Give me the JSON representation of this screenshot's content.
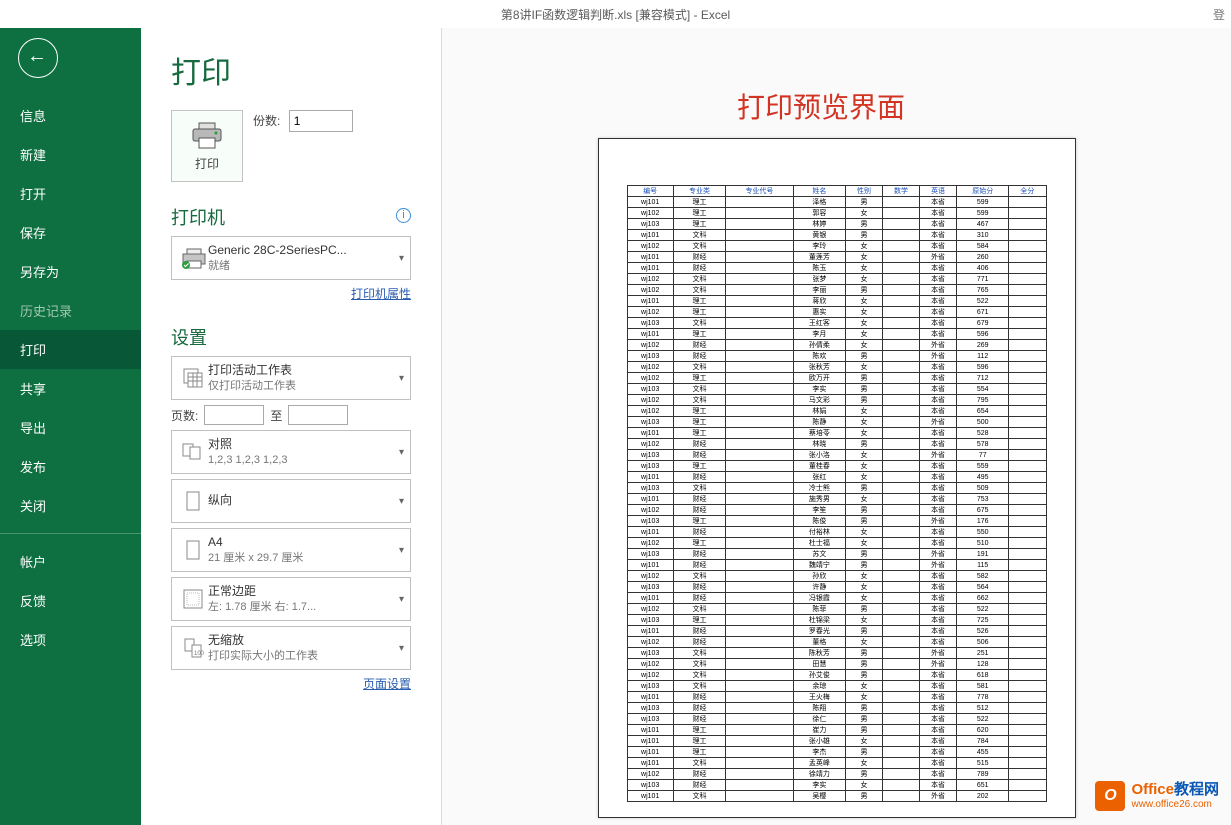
{
  "titlebar": {
    "text": "第8讲IF函数逻辑判断.xls  [兼容模式]  -  Excel",
    "right": "登"
  },
  "annotation": "打印预览界面",
  "sidebar": {
    "items": [
      "信息",
      "新建",
      "打开",
      "保存",
      "另存为",
      "历史记录",
      "打印",
      "共享",
      "导出",
      "发布",
      "关闭"
    ],
    "account_items": [
      "帐户",
      "反馈",
      "选项"
    ]
  },
  "print": {
    "title": "打印",
    "button_label": "打印",
    "copies_label": "份数:",
    "copies_value": "1"
  },
  "printer": {
    "section_title": "打印机",
    "name": "Generic 28C-2SeriesPC...",
    "status": "就绪",
    "properties_link": "打印机属性"
  },
  "settings": {
    "section_title": "设置",
    "scope": {
      "title": "打印活动工作表",
      "sub": "仅打印活动工作表"
    },
    "pages_label": "页数:",
    "pages_to": "至",
    "collate": {
      "title": "对照",
      "sub": "1,2,3    1,2,3    1,2,3"
    },
    "orientation": {
      "title": "纵向",
      "sub": ""
    },
    "paper": {
      "title": "A4",
      "sub": "21 厘米 x 29.7 厘米"
    },
    "margins": {
      "title": "正常边距",
      "sub": "左: 1.78 厘米   右: 1.7..."
    },
    "scaling": {
      "title": "无缩放",
      "sub": "打印实际大小的工作表"
    },
    "page_setup_link": "页面设置"
  },
  "preview": {
    "headers": [
      "编号",
      "专业类",
      "专业代号",
      "姓名",
      "性别",
      "数学",
      "英语",
      "原始分",
      "全分"
    ],
    "rows": [
      [
        "wj101",
        "理工",
        "",
        "泽格",
        "男",
        "",
        "本省",
        "599",
        ""
      ],
      [
        "wj102",
        "理工",
        "",
        "郭容",
        "女",
        "",
        "本省",
        "599",
        ""
      ],
      [
        "wj103",
        "理工",
        "",
        "林婷",
        "男",
        "",
        "本省",
        "467",
        ""
      ],
      [
        "wj101",
        "文科",
        "",
        "黄银",
        "男",
        "",
        "本省",
        "310",
        ""
      ],
      [
        "wj102",
        "文科",
        "",
        "李玲",
        "女",
        "",
        "本省",
        "584",
        ""
      ],
      [
        "wj101",
        "财经",
        "",
        "董莲芳",
        "女",
        "",
        "外省",
        "260",
        ""
      ],
      [
        "wj101",
        "财经",
        "",
        "陈玉",
        "女",
        "",
        "本省",
        "406",
        ""
      ],
      [
        "wj102",
        "文科",
        "",
        "张梦",
        "女",
        "",
        "本省",
        "771",
        ""
      ],
      [
        "wj102",
        "文科",
        "",
        "李丽",
        "男",
        "",
        "本省",
        "765",
        ""
      ],
      [
        "wj101",
        "理工",
        "",
        "蒋欣",
        "女",
        "",
        "本省",
        "522",
        ""
      ],
      [
        "wj102",
        "理工",
        "",
        "惠实",
        "女",
        "",
        "本省",
        "671",
        ""
      ],
      [
        "wj103",
        "文科",
        "",
        "王红客",
        "女",
        "",
        "本省",
        "679",
        ""
      ],
      [
        "wj101",
        "理工",
        "",
        "李月",
        "女",
        "",
        "本省",
        "596",
        ""
      ],
      [
        "wj102",
        "财经",
        "",
        "孙倩柔",
        "女",
        "",
        "外省",
        "269",
        ""
      ],
      [
        "wj103",
        "财经",
        "",
        "陈欢",
        "男",
        "",
        "外省",
        "112",
        ""
      ],
      [
        "wj102",
        "文科",
        "",
        "张秋芳",
        "女",
        "",
        "本省",
        "596",
        ""
      ],
      [
        "wj102",
        "理工",
        "",
        "欧万开",
        "男",
        "",
        "本省",
        "712",
        ""
      ],
      [
        "wj103",
        "文科",
        "",
        "李实",
        "男",
        "",
        "本省",
        "554",
        ""
      ],
      [
        "wj102",
        "文科",
        "",
        "马文彩",
        "男",
        "",
        "本省",
        "795",
        ""
      ],
      [
        "wj102",
        "理工",
        "",
        "林娟",
        "女",
        "",
        "本省",
        "654",
        ""
      ],
      [
        "wj103",
        "理工",
        "",
        "陈静",
        "女",
        "",
        "外省",
        "500",
        ""
      ],
      [
        "wj101",
        "理工",
        "",
        "蔡培苓",
        "女",
        "",
        "本省",
        "528",
        ""
      ],
      [
        "wj102",
        "财经",
        "",
        "林晓",
        "男",
        "",
        "本省",
        "578",
        ""
      ],
      [
        "wj103",
        "财经",
        "",
        "张小洛",
        "女",
        "",
        "外省",
        "77",
        ""
      ],
      [
        "wj103",
        "理工",
        "",
        "董桂春",
        "女",
        "",
        "本省",
        "559",
        ""
      ],
      [
        "wj101",
        "财经",
        "",
        "张红",
        "女",
        "",
        "本省",
        "495",
        ""
      ],
      [
        "wj103",
        "文科",
        "",
        "冷士熊",
        "男",
        "",
        "本省",
        "509",
        ""
      ],
      [
        "wj101",
        "财经",
        "",
        "施秀男",
        "女",
        "",
        "本省",
        "753",
        ""
      ],
      [
        "wj102",
        "财经",
        "",
        "李笙",
        "男",
        "",
        "本省",
        "675",
        ""
      ],
      [
        "wj103",
        "理工",
        "",
        "陈俊",
        "男",
        "",
        "外省",
        "176",
        ""
      ],
      [
        "wj101",
        "财经",
        "",
        "付裕林",
        "女",
        "",
        "本省",
        "550",
        ""
      ],
      [
        "wj102",
        "理工",
        "",
        "杜士福",
        "女",
        "",
        "本省",
        "510",
        ""
      ],
      [
        "wj103",
        "财经",
        "",
        "苏文",
        "男",
        "",
        "外省",
        "191",
        ""
      ],
      [
        "wj101",
        "财经",
        "",
        "魏靖宁",
        "男",
        "",
        "外省",
        "115",
        ""
      ],
      [
        "wj102",
        "文科",
        "",
        "孙欣",
        "女",
        "",
        "本省",
        "582",
        ""
      ],
      [
        "wj103",
        "财经",
        "",
        "许静",
        "女",
        "",
        "本省",
        "564",
        ""
      ],
      [
        "wj101",
        "财经",
        "",
        "冯银霞",
        "女",
        "",
        "本省",
        "662",
        ""
      ],
      [
        "wj102",
        "文科",
        "",
        "陈菲",
        "男",
        "",
        "本省",
        "522",
        ""
      ],
      [
        "wj103",
        "理工",
        "",
        "杜锦梁",
        "女",
        "",
        "本省",
        "725",
        ""
      ],
      [
        "wj101",
        "财经",
        "",
        "罗春光",
        "男",
        "",
        "本省",
        "526",
        ""
      ],
      [
        "wj102",
        "财经",
        "",
        "董格",
        "女",
        "",
        "本省",
        "506",
        ""
      ],
      [
        "wj103",
        "文科",
        "",
        "陈秋芳",
        "男",
        "",
        "外省",
        "251",
        ""
      ],
      [
        "wj102",
        "文科",
        "",
        "田慧",
        "男",
        "",
        "外省",
        "128",
        ""
      ],
      [
        "wj102",
        "文科",
        "",
        "孙艾俊",
        "男",
        "",
        "本省",
        "618",
        ""
      ],
      [
        "wj103",
        "文科",
        "",
        "余琼",
        "女",
        "",
        "本省",
        "581",
        ""
      ],
      [
        "wj101",
        "财经",
        "",
        "王火梅",
        "女",
        "",
        "本省",
        "778",
        ""
      ],
      [
        "wj103",
        "财经",
        "",
        "陈翔",
        "男",
        "",
        "本省",
        "512",
        ""
      ],
      [
        "wj103",
        "财经",
        "",
        "徐仁",
        "男",
        "",
        "本省",
        "522",
        ""
      ],
      [
        "wj101",
        "理工",
        "",
        "崔力",
        "男",
        "",
        "本省",
        "620",
        ""
      ],
      [
        "wj101",
        "理工",
        "",
        "张小雄",
        "女",
        "",
        "本省",
        "784",
        ""
      ],
      [
        "wj101",
        "理工",
        "",
        "李杰",
        "男",
        "",
        "本省",
        "455",
        ""
      ],
      [
        "wj101",
        "文科",
        "",
        "孟英峰",
        "女",
        "",
        "本省",
        "515",
        ""
      ],
      [
        "wj102",
        "财经",
        "",
        "徐靖力",
        "男",
        "",
        "本省",
        "789",
        ""
      ],
      [
        "wj103",
        "财经",
        "",
        "李实",
        "女",
        "",
        "本省",
        "651",
        ""
      ],
      [
        "wj101",
        "文科",
        "",
        "吴樱",
        "男",
        "",
        "外省",
        "202",
        ""
      ]
    ]
  },
  "watermark": {
    "title_part1": "Office",
    "title_part2": "教程网",
    "url": "www.office26.com"
  }
}
